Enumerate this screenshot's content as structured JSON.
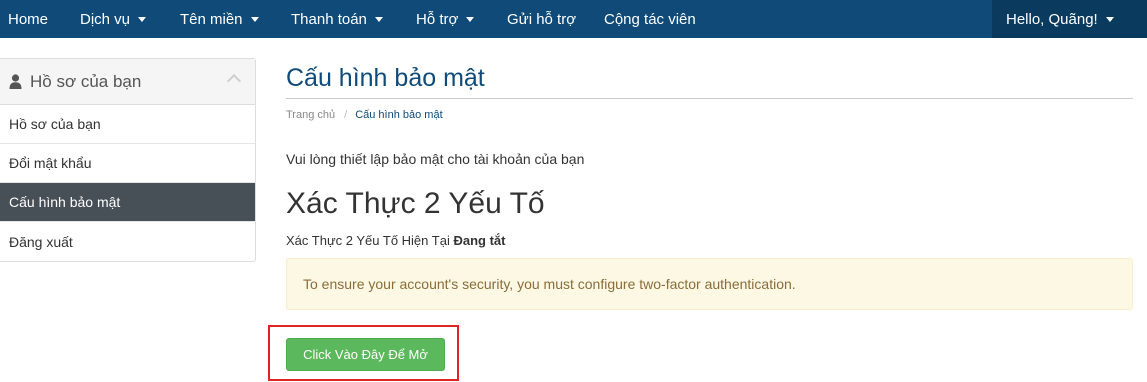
{
  "navbar": {
    "items": [
      {
        "label": "Home",
        "dropdown": false
      },
      {
        "label": "Dịch vụ",
        "dropdown": true
      },
      {
        "label": "Tên miền",
        "dropdown": true
      },
      {
        "label": "Thanh toán",
        "dropdown": true
      },
      {
        "label": "Hỗ trợ",
        "dropdown": true
      },
      {
        "label": "Gửi hỗ trợ",
        "dropdown": false
      },
      {
        "label": "Cộng tác viên",
        "dropdown": false
      }
    ],
    "user_label": "Hello, Quãng!",
    "background": "#0f4a78"
  },
  "sidebar": {
    "title": "Hồ sơ của bạn",
    "items": [
      {
        "label": "Hồ sơ của bạn",
        "active": false
      },
      {
        "label": "Đổi mật khẩu",
        "active": false
      },
      {
        "label": "Cấu hình bảo mật",
        "active": true
      },
      {
        "label": "Đăng xuất",
        "active": false
      }
    ]
  },
  "main": {
    "title": "Cấu hình bảo mật",
    "breadcrumb": {
      "home": "Trang chủ",
      "separator": "/",
      "current": "Cấu hình bảo mật"
    },
    "intro": "Vui lòng thiết lập bảo mật cho tài khoản của bạn",
    "tfa_heading": "Xác Thực 2 Yếu Tố",
    "tfa_status_prefix": "Xác Thực 2 Yếu Tố Hiện Tại",
    "tfa_status_value": "Đang tắt",
    "alert_text": "To ensure your account's security, you must configure two-factor authentication.",
    "enable_button": "Click Vào Đây Để Mở"
  },
  "colors": {
    "accent": "#0f4a78",
    "success": "#5cb85c",
    "highlight": "#e02424",
    "alert_bg": "#fcf8e3"
  }
}
